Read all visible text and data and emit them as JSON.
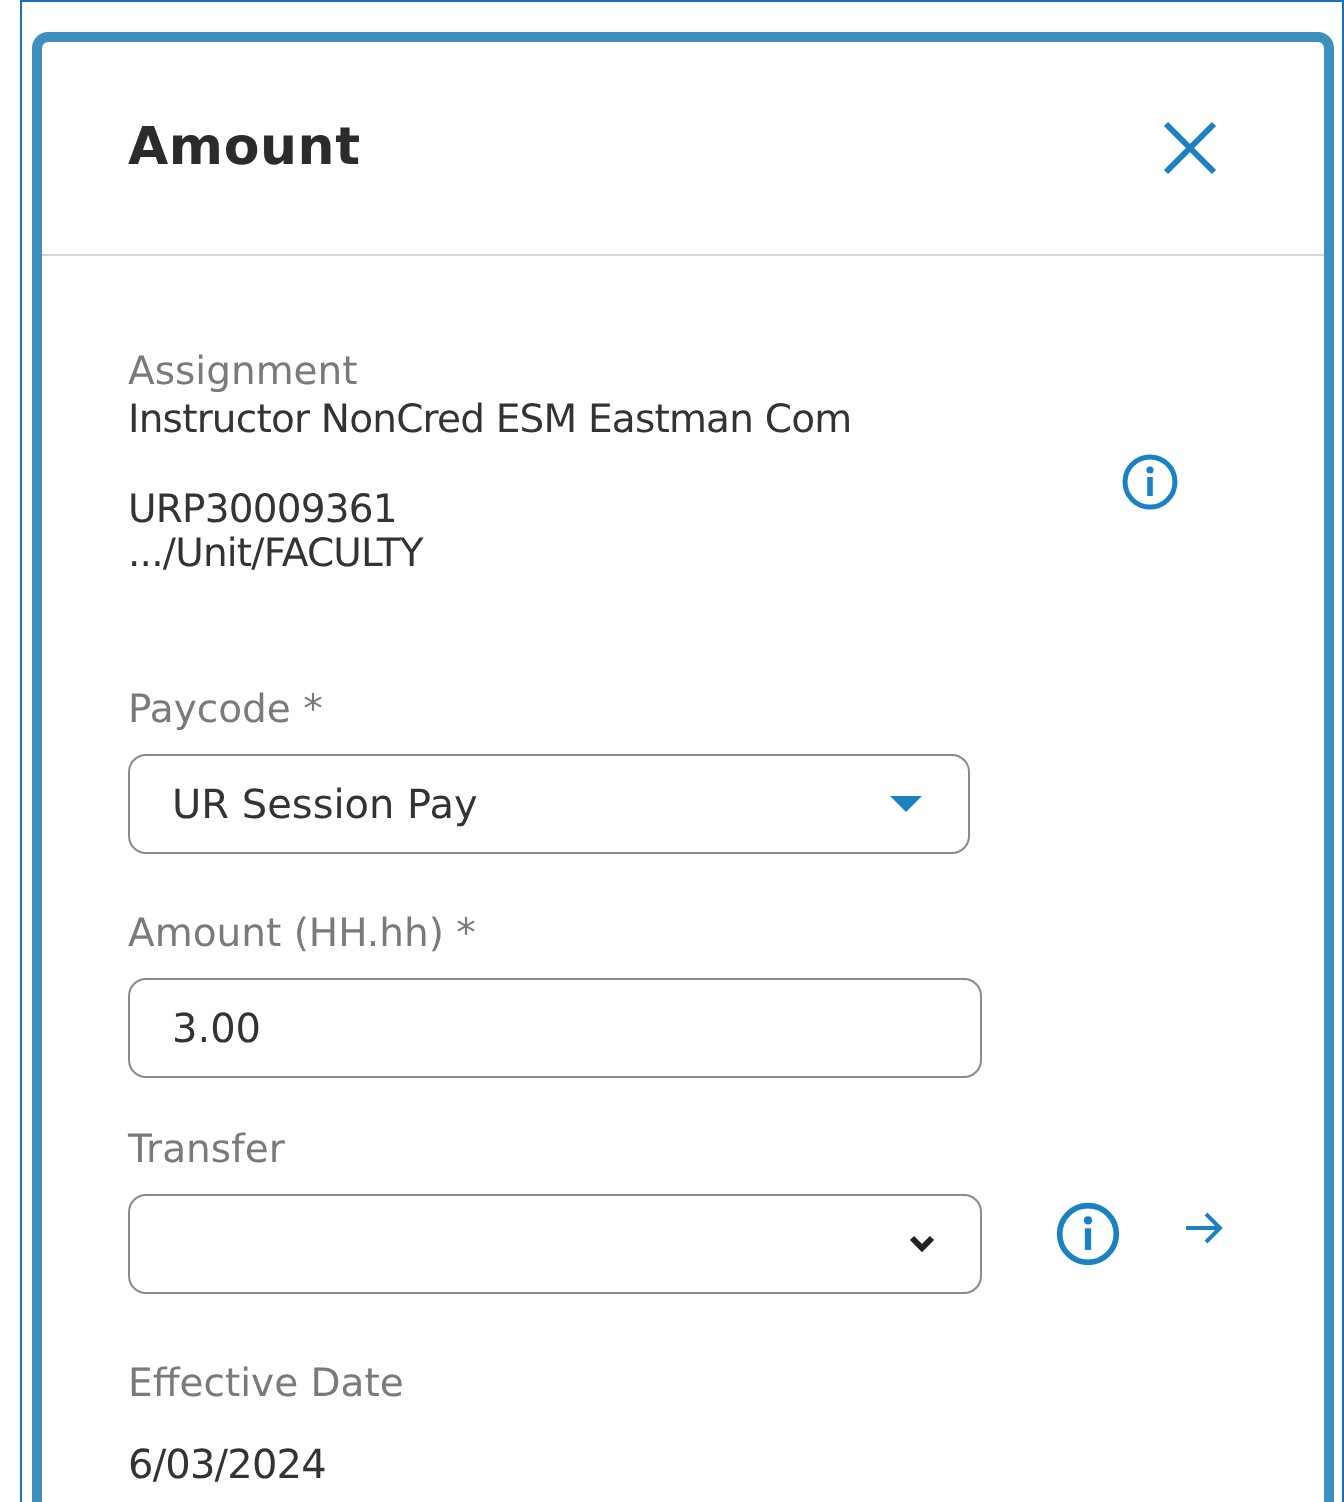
{
  "dialog": {
    "title": "Amount"
  },
  "assignment": {
    "label": "Assignment",
    "name": "Instructor NonCred ESM Eastman Com",
    "code": "URP30009361",
    "path": ".../Unit/FACULTY"
  },
  "fields": [
    {
      "kind": "dropdown",
      "label": "Paycode *",
      "value": "UR Session Pay"
    },
    {
      "kind": "input",
      "label": "Amount (HH.hh) *",
      "value": "3.00"
    },
    {
      "kind": "select",
      "label": "Transfer"
    },
    {
      "kind": "readonly",
      "label": "Effective Date",
      "value": "6/03/2024"
    }
  ]
}
